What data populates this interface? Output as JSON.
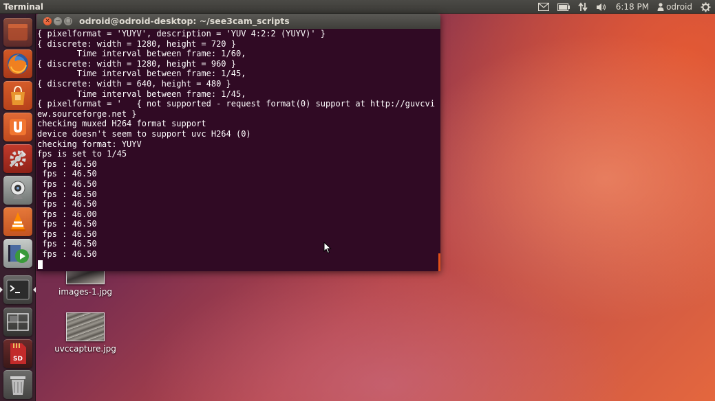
{
  "top_panel": {
    "app_title": "Terminal",
    "indicators": {
      "mail_icon": "envelope-icon",
      "battery_icon": "battery-icon",
      "network_icon": "network-arrows-icon",
      "sound_icon": "speaker-icon",
      "clock": "6:18 PM",
      "user_icon": "person-icon",
      "username": "odroid",
      "session_icon": "gear-icon"
    }
  },
  "launcher": {
    "items": [
      {
        "name": "dash-home",
        "icon": "dash-icon"
      },
      {
        "name": "firefox",
        "icon": "firefox-icon"
      },
      {
        "name": "software-center",
        "icon": "shopping-bag-icon"
      },
      {
        "name": "ubuntu-one",
        "icon": "ubuntu-one-icon"
      },
      {
        "name": "system-settings",
        "icon": "settings-icon"
      },
      {
        "name": "webcam",
        "icon": "webcam-icon"
      },
      {
        "name": "vlc",
        "icon": "vlc-icon"
      },
      {
        "name": "video-player",
        "icon": "video-play-icon"
      },
      {
        "name": "terminal",
        "icon": "terminal-icon"
      },
      {
        "name": "workspace-switcher",
        "icon": "workspace-icon"
      },
      {
        "name": "sd-card",
        "icon": "sd-card-icon"
      },
      {
        "name": "trash",
        "icon": "trash-icon"
      }
    ]
  },
  "desktop": {
    "icons": [
      {
        "label": "images-1.jpg"
      },
      {
        "label": "uvccapture.jpg"
      }
    ]
  },
  "terminal": {
    "window_title": "odroid@odroid-desktop: ~/see3cam_scripts",
    "lines": [
      "{ pixelformat = 'YUYV', description = 'YUV 4:2:2 (YUYV)' }",
      "{ discrete: width = 1280, height = 720 }",
      "        Time interval between frame: 1/60,",
      "{ discrete: width = 1280, height = 960 }",
      "        Time interval between frame: 1/45,",
      "{ discrete: width = 640, height = 480 }",
      "        Time interval between frame: 1/45,",
      "{ pixelformat = '   { not supported - request format(0) support at http://guvcvi",
      "ew.sourceforge.net }",
      "checking muxed H264 format support",
      "device doesn't seem to support uvc H264 (0)",
      "checking format: YUYV",
      "fps is set to 1/45",
      " fps : 46.50",
      " fps : 46.50",
      " fps : 46.50",
      " fps : 46.50",
      " fps : 46.50",
      " fps : 46.00",
      " fps : 46.50",
      " fps : 46.50",
      " fps : 46.50",
      " fps : 46.50"
    ]
  },
  "colors": {
    "terminal_background": "#300a24",
    "terminal_text": "#ffffff",
    "close_button": "#df4a16",
    "panel": "#3c3b37"
  }
}
